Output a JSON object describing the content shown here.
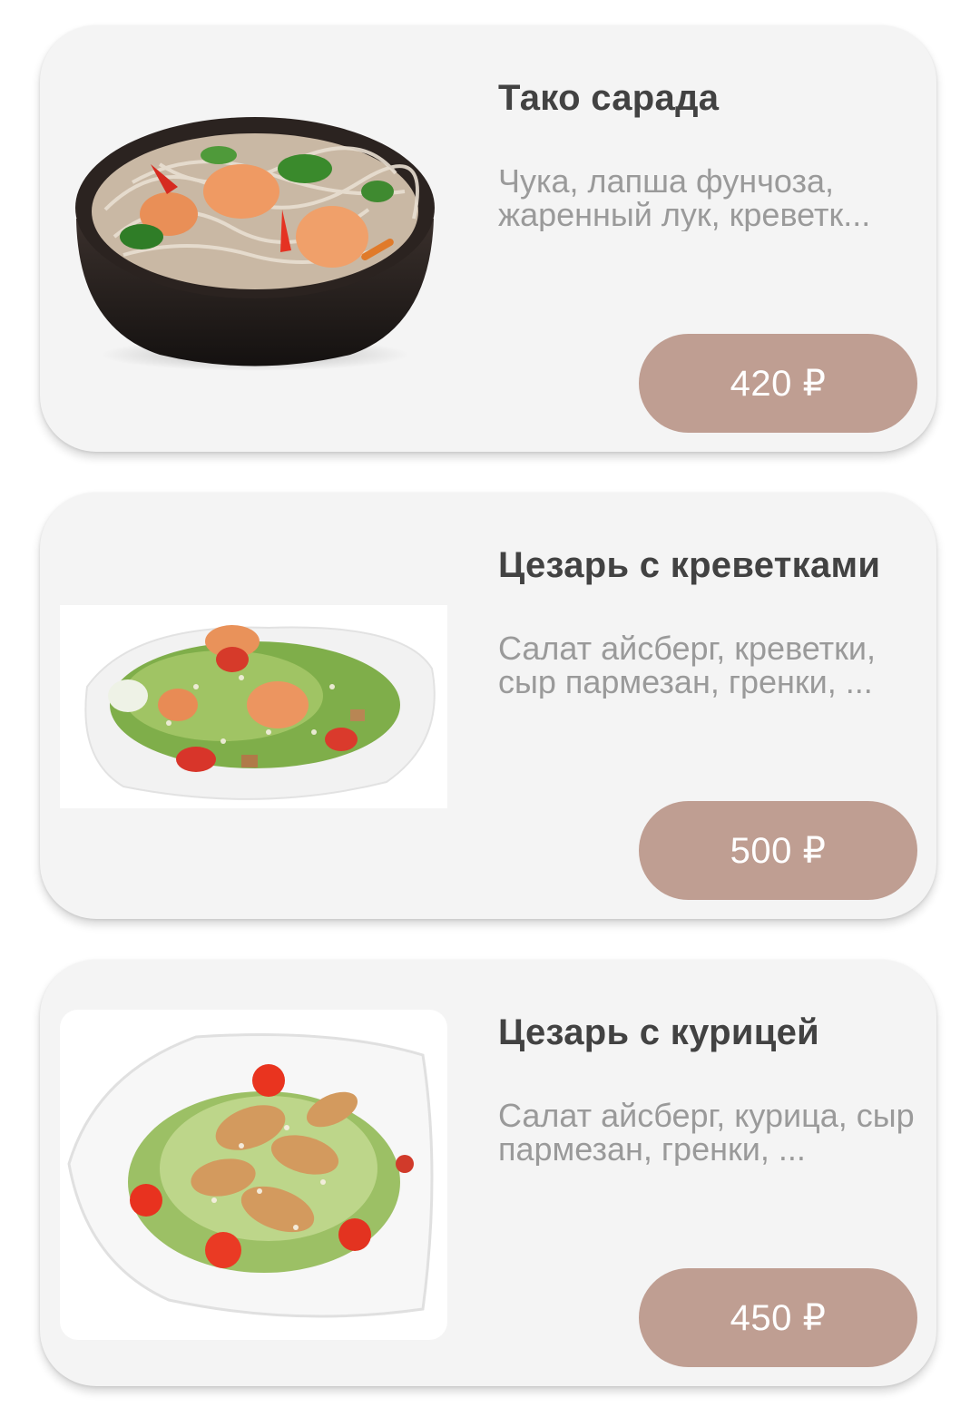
{
  "items": [
    {
      "name": "Тако сарада",
      "description": "Чука, лапша фунчоза, жаренный лук, креветк...",
      "price": "420 ₽",
      "image": "noodle-bowl-shrimp-image"
    },
    {
      "name": "Цезарь с креветками",
      "description": "Салат айсберг, креветки, сыр пармезан, гренки, ...",
      "price": "500 ₽",
      "image": "caesar-shrimp-salad-image"
    },
    {
      "name": "Цезарь с курицей",
      "description": "Салат айсберг, курица, сыр пармезан, гренки, ...",
      "price": "450 ₽",
      "image": "caesar-chicken-salad-image"
    }
  ],
  "colors": {
    "card_background": "#f4f4f4",
    "price_button": "#bf9e92",
    "title_text": "#424242",
    "description_text": "#9a9a9a"
  }
}
